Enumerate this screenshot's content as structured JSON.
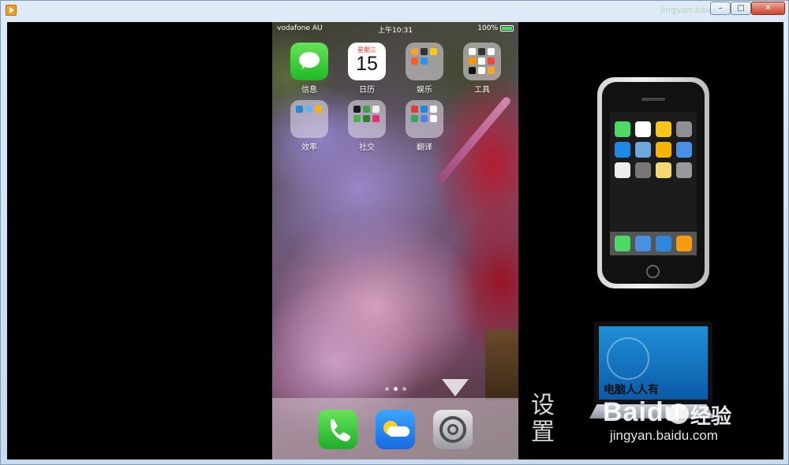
{
  "window": {
    "controls": {
      "minimize": "–",
      "maximize": "□",
      "close": "✕"
    },
    "title_ghost": "jingyan.baidu.com"
  },
  "phone": {
    "status": {
      "carrier": "vodafone AU",
      "time": "上午10:31",
      "battery": "100%"
    },
    "apps": [
      {
        "label": "信息",
        "icon": "messages-icon"
      },
      {
        "label": "日历",
        "icon": "calendar-icon",
        "weekday": "星期三",
        "day": "15"
      },
      {
        "label": "娱乐",
        "icon": "folder-icon"
      },
      {
        "label": "工具",
        "icon": "folder-icon"
      },
      {
        "label": "效率",
        "icon": "folder-icon"
      },
      {
        "label": "社交",
        "icon": "folder-icon"
      },
      {
        "label": "翻译",
        "icon": "folder-icon"
      }
    ],
    "page_indicator": {
      "pages": 3,
      "current": 2
    },
    "dock": [
      {
        "icon": "phone-icon"
      },
      {
        "icon": "weather-icon"
      },
      {
        "icon": "settings-icon"
      }
    ]
  },
  "overlay": {
    "laptop_caption": "电脑人人有",
    "side_caption": "设置",
    "watermark_brand": "Baidu",
    "watermark_suffix": "经验",
    "watermark_url": "jingyan.baidu.com"
  },
  "colors": {
    "accent_green": "#4cd964",
    "close_red": "#c9462c",
    "frame_blue": "#cfe0f0"
  }
}
